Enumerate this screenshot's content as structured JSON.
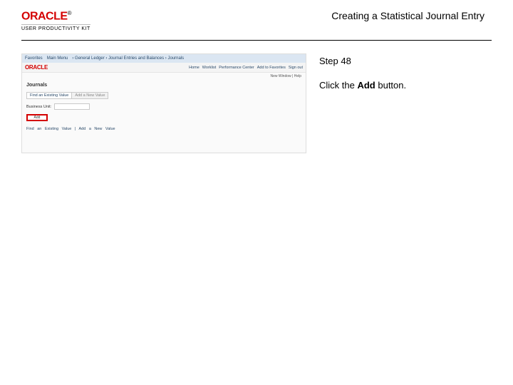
{
  "header": {
    "logo_text": "ORACLE",
    "logo_tm": "®",
    "subtitle": "USER PRODUCTIVITY KIT",
    "page_title": "Creating a Statistical Journal Entry"
  },
  "instructions": {
    "step_label": "Step 48",
    "click_pre": "Click the ",
    "click_bold": "Add",
    "click_post": " button."
  },
  "screenshot": {
    "breadcrumb": {
      "item1": "Favorites",
      "item2": "Main Menu",
      "item3": "General Ledger",
      "item4": "Journals",
      "item5": "Journal Entries and Balances",
      "item6": "Journals"
    },
    "logo": "ORACLE",
    "nav": {
      "home": "Home",
      "worklist": "Worklist",
      "perf": "Performance Center",
      "add_fav": "Add to Favorites",
      "signout": "Sign out"
    },
    "subbar": "New Window | Help",
    "heading": "Journals",
    "tabs": {
      "t1": "Find an Existing Value",
      "t2": "Add a New Value"
    },
    "field_label": "Business Unit:",
    "field_value": "",
    "add_label": "Add",
    "footer": "Find an Existing Value | Add a New Value"
  }
}
